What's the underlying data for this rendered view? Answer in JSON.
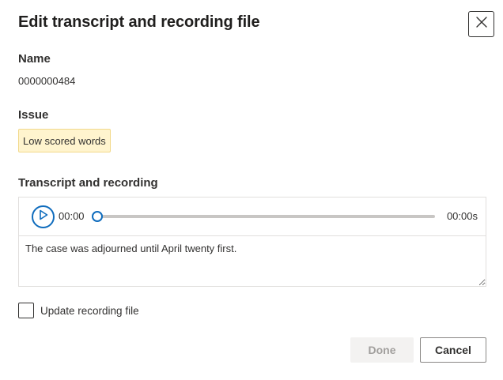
{
  "dialog": {
    "title": "Edit transcript and recording file",
    "close_icon": "close-icon"
  },
  "name": {
    "label": "Name",
    "value": "0000000484"
  },
  "issue": {
    "label": "Issue",
    "badge": "Low scored words",
    "badge_color": "#fff4ce"
  },
  "recording": {
    "label": "Transcript and recording",
    "play_icon": "play-icon",
    "current_time": "00:00",
    "total_time": "00:00s",
    "progress": 0,
    "transcript_text": "The case was adjourned until April twenty first."
  },
  "update_recording": {
    "label": "Update recording file",
    "checked": false
  },
  "actions": {
    "done_label": "Done",
    "cancel_label": "Cancel"
  },
  "colors": {
    "accent": "#0f6cbd",
    "text": "#323130"
  }
}
